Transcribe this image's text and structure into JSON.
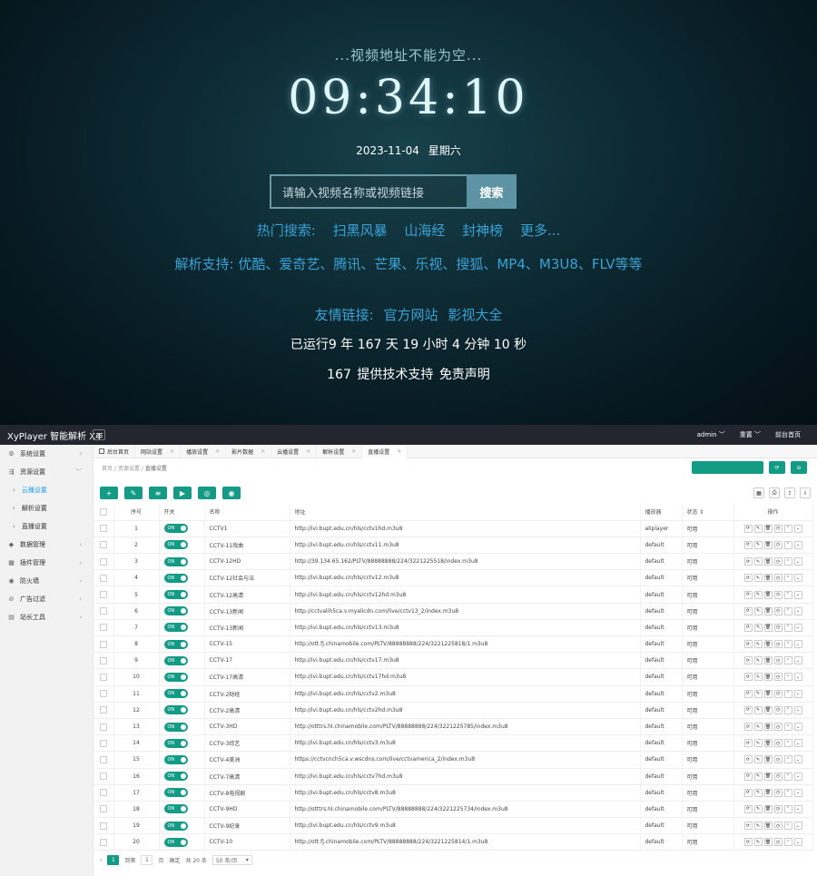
{
  "hero": {
    "tip": "...视频地址不能为空...",
    "clock": "09:34:10",
    "date": "2023-11-04",
    "weekday": "星期六",
    "search_placeholder": "请输入视频名称或视频链接",
    "search_button": "搜索",
    "hot_label": "热门搜索:",
    "hot_items": [
      "扫黑风暴",
      "山海经",
      "封神榜",
      "更多..."
    ],
    "parse_support": "解析支持: 优酷、爱奇艺、腾讯、芒果、乐视、搜狐、MP4、M3U8、FLV等等",
    "friend_label": "友情链接:",
    "friend_links": [
      "官方网站",
      "影视大全"
    ],
    "uptime": "已运行9 年 167 天 19 小时 4 分钟 10 秒",
    "support_prefix": "167",
    "support_text": "提供技术支持",
    "disclaimer": "免责声明"
  },
  "topbar": {
    "brand": "XyPlayer 智能解析 X4",
    "user": "admin ﹀",
    "reset": "重置 ﹀",
    "front": "前台首页"
  },
  "sidebar": {
    "items": [
      {
        "label": "系统设置",
        "icon": "gear-icon",
        "glyph": "⚙"
      },
      {
        "label": "资源设置",
        "icon": "resource-icon",
        "glyph": "⇶"
      },
      {
        "label": "云播设置",
        "sub": true,
        "active": true
      },
      {
        "label": "解析设置",
        "sub": true
      },
      {
        "label": "直播设置",
        "sub": true
      },
      {
        "label": "数据管理",
        "icon": "database-icon",
        "glyph": "◆"
      },
      {
        "label": "插件管理",
        "icon": "plugin-icon",
        "glyph": "▦"
      },
      {
        "label": "防火墙",
        "icon": "firewall-icon",
        "glyph": "◉"
      },
      {
        "label": "广告过滤",
        "icon": "filter-icon",
        "glyph": "⊘"
      },
      {
        "label": "站长工具",
        "icon": "tools-icon",
        "glyph": "▤"
      }
    ]
  },
  "tabs": [
    {
      "label": "后台首页",
      "home": true
    },
    {
      "label": "网站设置"
    },
    {
      "label": "播放设置"
    },
    {
      "label": "影片数据"
    },
    {
      "label": "云播设置"
    },
    {
      "label": "解析设置"
    },
    {
      "label": "直播设置",
      "on": true
    }
  ],
  "breadcrumb": {
    "a": "首页",
    "b": "资源设置",
    "c": "直播设置"
  },
  "toolbar_icons": [
    "+",
    "✎",
    "≡",
    "▶",
    "◎",
    "◉"
  ],
  "tools_right": [
    "▦",
    "⎙",
    "⇪",
    "⇩"
  ],
  "table": {
    "headers": {
      "no": "序号",
      "switch": "开关",
      "name": "名称",
      "url": "地址",
      "player": "播放器",
      "status": "状态 ⇕",
      "ops": "操作"
    },
    "switch_label": "ON",
    "rows": [
      {
        "no": "1",
        "name": "CCTV1",
        "url": "http://ivi.bupt.edu.cn/hls/cctv1hd.m3u8",
        "player": "aliplayer",
        "status": "可用"
      },
      {
        "no": "2",
        "name": "CCTV-11戏曲",
        "url": "http://ivi.bupt.edu.cn/hls/cctv11.m3u8",
        "player": "default",
        "status": "可用"
      },
      {
        "no": "3",
        "name": "CCTV-12HD",
        "url": "http://39.134.65.162/PLTV/88888888/224/3221225518/index.m3u8",
        "player": "default",
        "status": "可用"
      },
      {
        "no": "4",
        "name": "CCTV-12社会与法",
        "url": "http://ivi.bupt.edu.cn/hls/cctv12.m3u8",
        "player": "default",
        "status": "可用"
      },
      {
        "no": "5",
        "name": "CCTV-12高清",
        "url": "http://ivi.bupt.edu.cn/hls/cctv12hd.m3u8",
        "player": "default",
        "status": "可用"
      },
      {
        "no": "6",
        "name": "CCTV-13新闻",
        "url": "http://cctvalih5ca.v.myalicdn.com/live/cctv13_2/index.m3u8",
        "player": "default",
        "status": "可用"
      },
      {
        "no": "7",
        "name": "CCTV-13新闻",
        "url": "http://ivi.bupt.edu.cn/hls/cctv13.m3u8",
        "player": "default",
        "status": "可用"
      },
      {
        "no": "8",
        "name": "CCTV-15",
        "url": "http://ott.fj.chinamobile.com/PLTV/88888888/224/3221225818/1.m3u8",
        "player": "default",
        "status": "可用"
      },
      {
        "no": "9",
        "name": "CCTV-17",
        "url": "http://ivi.bupt.edu.cn/hls/cctv17.m3u8",
        "player": "default",
        "status": "可用"
      },
      {
        "no": "10",
        "name": "CCTV-17高清",
        "url": "http://ivi.bupt.edu.cn/hls/cctv17hd.m3u8",
        "player": "default",
        "status": "可用"
      },
      {
        "no": "11",
        "name": "CCTV-2财经",
        "url": "http://ivi.bupt.edu.cn/hls/cctv2.m3u8",
        "player": "default",
        "status": "可用"
      },
      {
        "no": "12",
        "name": "CCTV-2高清",
        "url": "http://ivi.bupt.edu.cn/hls/cctv2hd.m3u8",
        "player": "default",
        "status": "可用"
      },
      {
        "no": "13",
        "name": "CCTV-3HD",
        "url": "http://otttrs.hl.chinamobile.com/PLTV/88888888/224/3221225785/index.m3u8",
        "player": "default",
        "status": "可用"
      },
      {
        "no": "14",
        "name": "CCTV-3综艺",
        "url": "http://ivi.bupt.edu.cn/hls/cctv3.m3u8",
        "player": "default",
        "status": "可用"
      },
      {
        "no": "15",
        "name": "CCTV-4美洲",
        "url": "https://cctvcnch5ca.v.wscdns.com/live/cctvamerica_2/index.m3u8",
        "player": "default",
        "status": "可用"
      },
      {
        "no": "16",
        "name": "CCTV-7高清",
        "url": "http://ivi.bupt.edu.cn/hls/cctv7hd.m3u8",
        "player": "default",
        "status": "可用"
      },
      {
        "no": "17",
        "name": "CCTV-8电视剧",
        "url": "http://ivi.bupt.edu.cn/hls/cctv8.m3u8",
        "player": "default",
        "status": "可用"
      },
      {
        "no": "18",
        "name": "CCTV-9HD",
        "url": "http://otttrs.hl.chinamobile.com/PLTV/88888888/224/3221225734/index.m3u8",
        "player": "default",
        "status": "可用"
      },
      {
        "no": "19",
        "name": "CCTV-9纪录",
        "url": "http://ivi.bupt.edu.cn/hls/cctv9.m3u8",
        "player": "default",
        "status": "可用"
      },
      {
        "no": "20",
        "name": "CCTV-10",
        "url": "http://ott.fj.chinamobile.com/PLTV/88888888/224/3221225814/1.m3u8",
        "player": "default",
        "status": "可用"
      }
    ]
  },
  "pager": {
    "prev": "‹",
    "page": "1",
    "goto": "到第",
    "input": "1",
    "unit": "页",
    "ok": "确定",
    "total": "共 20 条",
    "size": "50 条/页"
  },
  "colors": {
    "accent": "#139b86",
    "link": "#3aa3d6",
    "topbar": "#23262e"
  }
}
